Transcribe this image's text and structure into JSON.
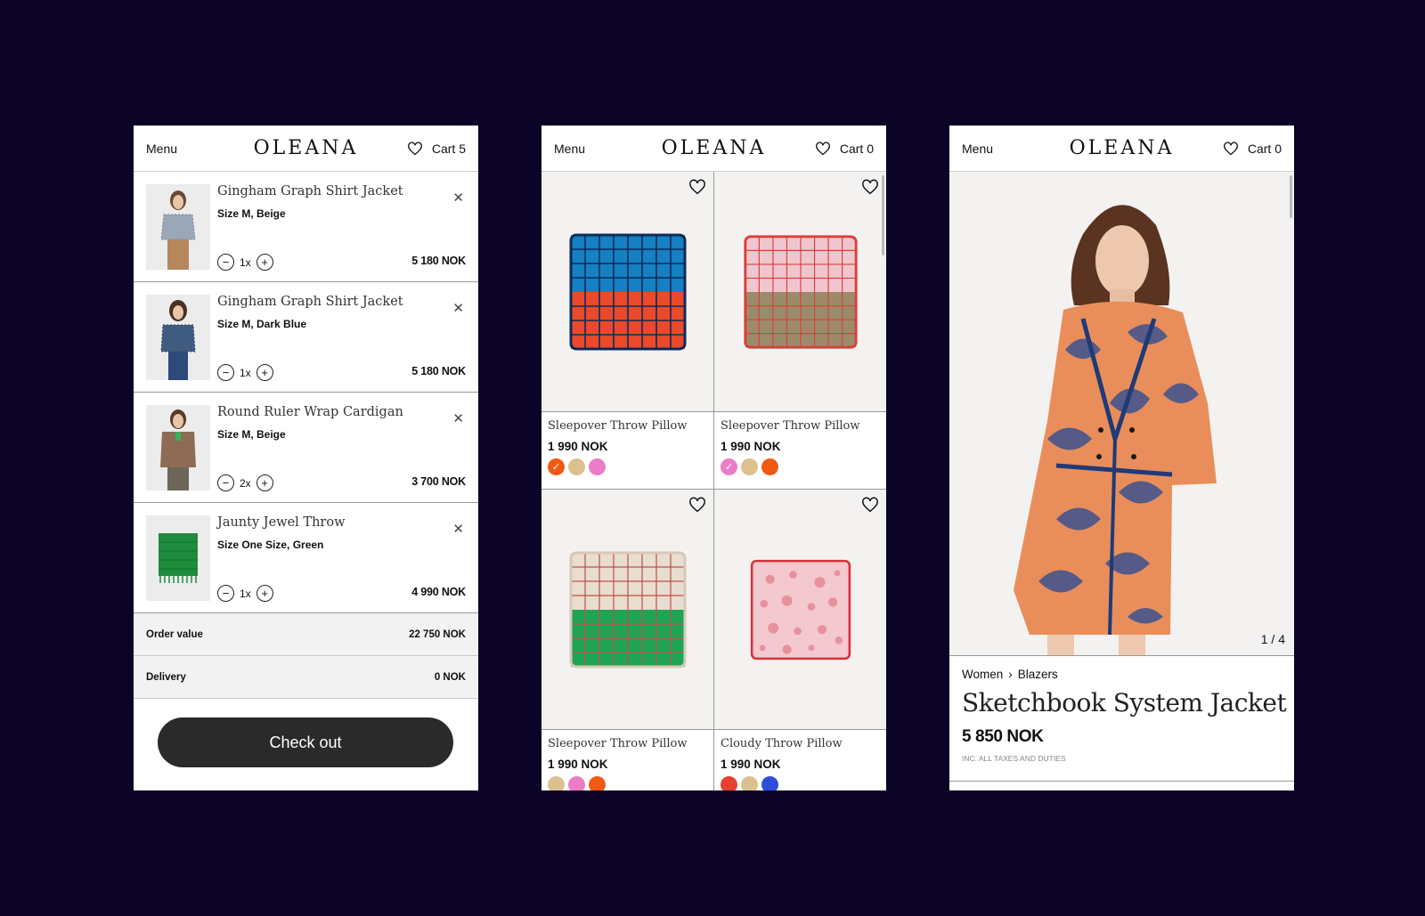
{
  "header": {
    "menu_label": "Menu",
    "logo": "OLEANA"
  },
  "cart_screen": {
    "cart_label": "Cart 5",
    "items": [
      {
        "title": "Gingham Graph Shirt Jacket",
        "variant": "Size M, Beige",
        "qty": "1x",
        "price": "5 180 NOK"
      },
      {
        "title": "Gingham Graph Shirt Jacket",
        "variant": "Size M, Dark Blue",
        "qty": "1x",
        "price": "5 180 NOK"
      },
      {
        "title": "Round Ruler Wrap Cardigan",
        "variant": "Size M, Beige",
        "qty": "2x",
        "price": "3 700 NOK"
      },
      {
        "title": "Jaunty Jewel Throw",
        "variant": "Size One Size, Green",
        "qty": "1x",
        "price": "4 990 NOK"
      }
    ],
    "order_value_label": "Order value",
    "order_value": "22 750 NOK",
    "delivery_label": "Delivery",
    "delivery_value": "0 NOK",
    "checkout_label": "Check out"
  },
  "listing_screen": {
    "cart_label": "Cart 0",
    "products": [
      {
        "name": "Sleepover Throw Pillow",
        "price": "1 990 NOK",
        "swatches": [
          "#f05a14",
          "#dcc08f",
          "#ec7cc8"
        ]
      },
      {
        "name": "Sleepover Throw Pillow",
        "price": "1 990 NOK",
        "swatches": [
          "#ec7cc8",
          "#dcc08f",
          "#f05a14"
        ]
      },
      {
        "name": "Sleepover Throw Pillow",
        "price": "1 990 NOK",
        "swatches": [
          "#dcc08f",
          "#ec7cc8",
          "#f05a14"
        ]
      },
      {
        "name": "Cloudy Throw Pillow",
        "price": "1 990 NOK",
        "swatches": [
          "#e84030",
          "#dcc08f",
          "#2c4fd6"
        ]
      }
    ]
  },
  "product_screen": {
    "cart_label": "Cart 0",
    "pager": "1 / 4",
    "breadcrumb": [
      "Women",
      "Blazers"
    ],
    "title": "Sketchbook System Jacket",
    "price": "5 850 NOK",
    "tax_note": "INC. ALL TAXES AND DUTIES"
  }
}
